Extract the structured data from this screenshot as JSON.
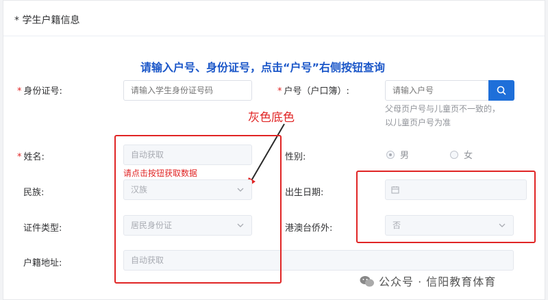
{
  "section": {
    "title": "* 学生户籍信息"
  },
  "hint": "请输入户号、身份证号，点击“户号”右侧按钮查询",
  "fields": {
    "id_number": {
      "label": "身份证号:",
      "placeholder": "请输入学生身份证号码"
    },
    "household_no": {
      "label": "户号（户口簿）:",
      "placeholder": "请输入户号",
      "note_line1": "父母页户号与儿童页不一致的，",
      "note_line2": "以儿童页户号为准"
    },
    "name": {
      "label": "姓名:",
      "value": "自动获取",
      "error": "请点击按钮获取数据"
    },
    "gender": {
      "label": "性别:",
      "options": [
        "男",
        "女"
      ],
      "selected": "男"
    },
    "ethnicity": {
      "label": "民族:",
      "value": "汉族"
    },
    "birth_date": {
      "label": "出生日期:"
    },
    "id_type": {
      "label": "证件类型:",
      "value": "居民身份证"
    },
    "overseas": {
      "label": "港澳台侨外:",
      "value": "否"
    },
    "domicile": {
      "label": "户籍地址:",
      "value": "自动获取"
    }
  },
  "annotation": "灰色底色",
  "watermark": "公众号 · 信阳教育体育",
  "colors": {
    "accent": "#1e6fd9",
    "annotation": "#e02424",
    "hint": "#1a56c8"
  },
  "icons": {
    "search": "search-icon",
    "calendar": "calendar-icon",
    "arrow": "chevron-down-icon",
    "wechat": "wechat-icon"
  }
}
